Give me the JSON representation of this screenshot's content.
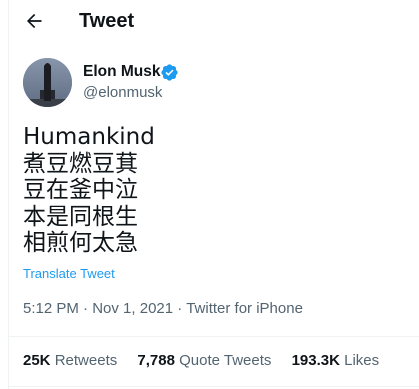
{
  "header": {
    "title": "Tweet",
    "back_icon": "arrow-left-icon"
  },
  "author": {
    "name": "Elon Musk",
    "handle": "@elonmusk",
    "verified_icon": "verified-badge-icon"
  },
  "tweet": {
    "lines": [
      "Humankind",
      "煮豆燃豆萁",
      "豆在釜中泣",
      "本是同根生",
      "相煎何太急"
    ],
    "translate_label": "Translate Tweet",
    "time": "5:12 PM",
    "date": "Nov 1, 2021",
    "source": "Twitter for iPhone"
  },
  "stats": {
    "retweets": {
      "count": "25K",
      "label": "Retweets"
    },
    "quotes": {
      "count": "7,788",
      "label": "Quote Tweets"
    },
    "likes": {
      "count": "193.3K",
      "label": "Likes"
    }
  },
  "colors": {
    "accent": "#1d9bf0",
    "text": "#0f1419",
    "secondary": "#536471",
    "divider": "#eff3f4"
  }
}
